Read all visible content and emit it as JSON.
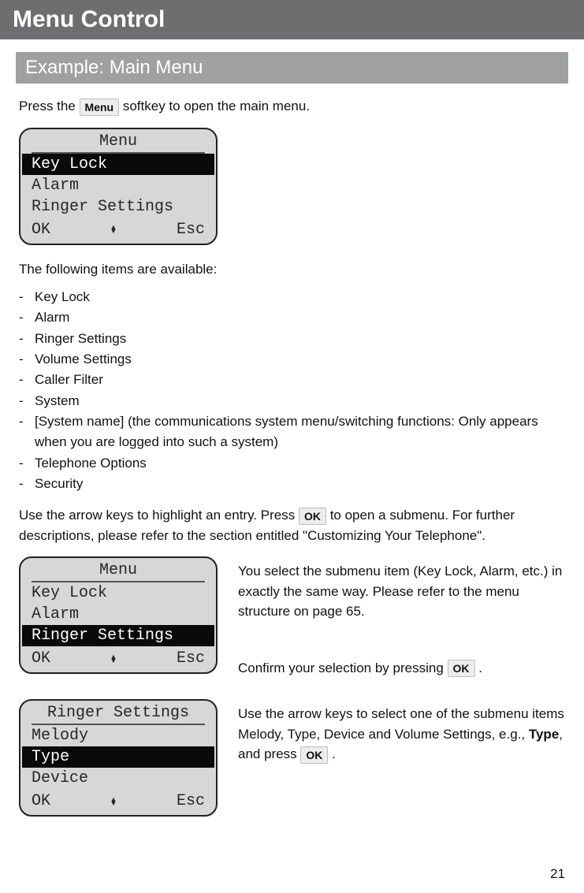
{
  "title": "Menu Control",
  "section": "Example: Main Menu",
  "intro_a": "Press the ",
  "intro_key": "Menu",
  "intro_b": " softkey to open the main menu.",
  "lcd1": {
    "title": "Menu",
    "r1": "Key Lock",
    "r2": "Alarm",
    "r3": "Ringer Settings",
    "ok": "OK",
    "esc": "Esc"
  },
  "avail_heading": "The following items are available:",
  "items": {
    "i0": "Key Lock",
    "i1": "Alarm",
    "i2": "Ringer Settings",
    "i3": "Volume Settings",
    "i4": "Caller Filter",
    "i5": "System",
    "i6": "[System name] (the communications system menu/switching functions: Only appears when you are logged into such a system)",
    "i7": "Telephone Options",
    "i8": "Security"
  },
  "arrow_a": "Use the arrow keys to highlight an entry. Press ",
  "arrow_key": "OK",
  "arrow_b": " to open a submenu. For further descriptions, please refer to the section entitled \"Customizing Your Telephone\".",
  "lcd2": {
    "title": "Menu",
    "r1": "Key Lock",
    "r2": "Alarm",
    "r3": "Ringer Settings",
    "ok": "OK",
    "esc": "Esc"
  },
  "right2_a": "You select the submenu item (Key Lock, Alarm, etc.) in exactly the same way. Please refer to the menu structure on page 65.",
  "right2_b_pre": "Confirm your selection by pressing ",
  "right2_b_key": "OK",
  "right2_b_post": " .",
  "lcd3": {
    "title": "Ringer Settings",
    "r1": "Melody",
    "r2": "Type",
    "r3": "Device",
    "ok": "OK",
    "esc": "Esc"
  },
  "right3_a": "Use the arrow keys to select one of the submenu items Melody, Type, Device and Volume Settings, e.g., ",
  "right3_bold": "Type",
  "right3_b": ", and press ",
  "right3_key": "OK",
  "right3_c": " .",
  "page": "21"
}
